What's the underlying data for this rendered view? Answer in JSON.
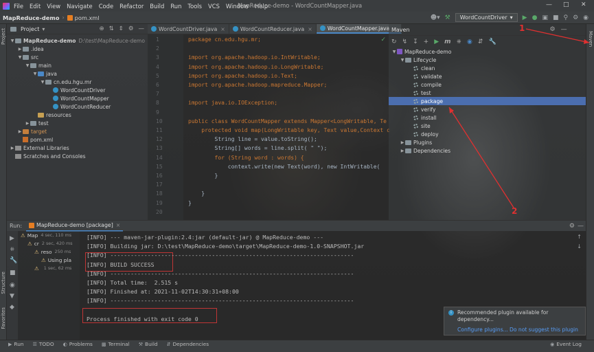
{
  "menu": {
    "items": [
      "File",
      "Edit",
      "View",
      "Navigate",
      "Code",
      "Refactor",
      "Build",
      "Run",
      "Tools",
      "VCS",
      "Window",
      "Help"
    ],
    "window_title": "MapReduce-demo - WordCountMapper.java"
  },
  "nav": {
    "project": "MapReduce-demo",
    "file": "pom.xml",
    "run_config": "WordCountDriver"
  },
  "project_panel": {
    "title": "Project",
    "tree": [
      {
        "label": "MapReduce-demo",
        "path": "D:\\test\\MapReduce-demo",
        "level": 0,
        "kind": "module",
        "open": true
      },
      {
        "label": ".idea",
        "level": 1,
        "kind": "folder",
        "open": false
      },
      {
        "label": "src",
        "level": 1,
        "kind": "folder",
        "open": true
      },
      {
        "label": "main",
        "level": 2,
        "kind": "folder",
        "open": true
      },
      {
        "label": "java",
        "level": 3,
        "kind": "folder-blue",
        "open": true
      },
      {
        "label": "cn.edu.hgu.mr",
        "level": 4,
        "kind": "folder",
        "open": true
      },
      {
        "label": "WordCountDriver",
        "level": 5,
        "kind": "class"
      },
      {
        "label": "WordCountMapper",
        "level": 5,
        "kind": "class"
      },
      {
        "label": "WordCountReducer",
        "level": 5,
        "kind": "class"
      },
      {
        "label": "resources",
        "level": 3,
        "kind": "folder-yellow"
      },
      {
        "label": "test",
        "level": 2,
        "kind": "folder",
        "open": false
      },
      {
        "label": "target",
        "level": 1,
        "kind": "folder-orange",
        "open": false
      },
      {
        "label": "pom.xml",
        "level": 1,
        "kind": "pom"
      },
      {
        "label": "External Libraries",
        "level": 0,
        "kind": "lib",
        "open": false
      },
      {
        "label": "Scratches and Consoles",
        "level": 0,
        "kind": "scratch"
      }
    ]
  },
  "editor": {
    "tabs": [
      "WordCountDriver.java",
      "WordCountReducer.java",
      "WordCountMapper.java"
    ],
    "active_tab": 2,
    "line_numbers": [
      "1",
      "2",
      "3",
      "4",
      "5",
      "6",
      "7",
      "8",
      "9",
      "10",
      "11",
      "12",
      "13",
      "14",
      "15",
      "16",
      "17",
      "18",
      "19",
      "20"
    ],
    "lines": [
      "package cn.edu.hgu.mr;",
      "",
      "import org.apache.hadoop.io.IntWritable;",
      "import org.apache.hadoop.io.LongWritable;",
      "import org.apache.hadoop.io.Text;",
      "import org.apache.hadoop.mapreduce.Mapper;",
      "",
      "import java.io.IOException;",
      "",
      "public class WordCountMapper extends Mapper<LongWritable, Te",
      "    protected void map(LongWritable key, Text value,Context c",
      "        String line = value.toString();",
      "        String[] words = line.split( \" \");",
      "        for (String word : words) {",
      "            context.write(new Text(word), new IntWritable(",
      "        }",
      "",
      "    }",
      "}",
      ""
    ]
  },
  "maven": {
    "title": "Maven",
    "tree": [
      {
        "label": "MapReduce-demo",
        "level": 0,
        "kind": "module"
      },
      {
        "label": "Lifecycle",
        "level": 1,
        "kind": "folder"
      },
      {
        "label": "clean",
        "level": 2,
        "kind": "goal"
      },
      {
        "label": "validate",
        "level": 2,
        "kind": "goal"
      },
      {
        "label": "compile",
        "level": 2,
        "kind": "goal"
      },
      {
        "label": "test",
        "level": 2,
        "kind": "goal"
      },
      {
        "label": "package",
        "level": 2,
        "kind": "goal",
        "selected": true
      },
      {
        "label": "verify",
        "level": 2,
        "kind": "goal"
      },
      {
        "label": "install",
        "level": 2,
        "kind": "goal"
      },
      {
        "label": "site",
        "level": 2,
        "kind": "goal"
      },
      {
        "label": "deploy",
        "level": 2,
        "kind": "goal"
      },
      {
        "label": "Plugins",
        "level": 1,
        "kind": "folder"
      },
      {
        "label": "Dependencies",
        "level": 1,
        "kind": "folder"
      }
    ],
    "side_label": "Maven"
  },
  "annotations": {
    "one": "1",
    "two": "2"
  },
  "run_panel": {
    "label": "Run:",
    "tab": "MapReduce-demo [package]",
    "tree": [
      {
        "label": "Map",
        "meta": "4 sec, 110 ms"
      },
      {
        "label": "cr",
        "meta": "2 sec, 420 ms"
      },
      {
        "label": "reso",
        "meta": "250 ms"
      },
      {
        "label": "Using pla",
        "meta": ""
      },
      {
        "label": "",
        "meta": "1 sec, 62 ms"
      }
    ],
    "console": [
      "[INFO] --- maven-jar-plugin:2.4:jar (default-jar) @ MapReduce-demo ---",
      "[INFO] Building jar: D:\\test\\MapReduce-demo\\target\\MapReduce-demo-1.0-SNAPSHOT.jar",
      "[INFO] ------------------------------------------------------------------------",
      "[INFO] BUILD SUCCESS",
      "[INFO] ------------------------------------------------------------------------",
      "[INFO] Total time:  2.515 s",
      "[INFO] Finished at: 2021-11-02T14:30:31+08:00",
      "[INFO] ------------------------------------------------------------------------",
      "",
      "Process finished with exit code 0"
    ]
  },
  "notification": {
    "message": "Recommended plugin available for dependency...",
    "action_configure": "Configure plugins...",
    "action_dismiss": "Do not suggest this plugin"
  },
  "bottom_bar": [
    "Run",
    "TODO",
    "Problems",
    "Terminal",
    "Build",
    "Dependencies"
  ],
  "event_log": "Event Log",
  "strip_labels": {
    "project": "Project",
    "structure": "Structure",
    "favorites": "Favorites"
  }
}
